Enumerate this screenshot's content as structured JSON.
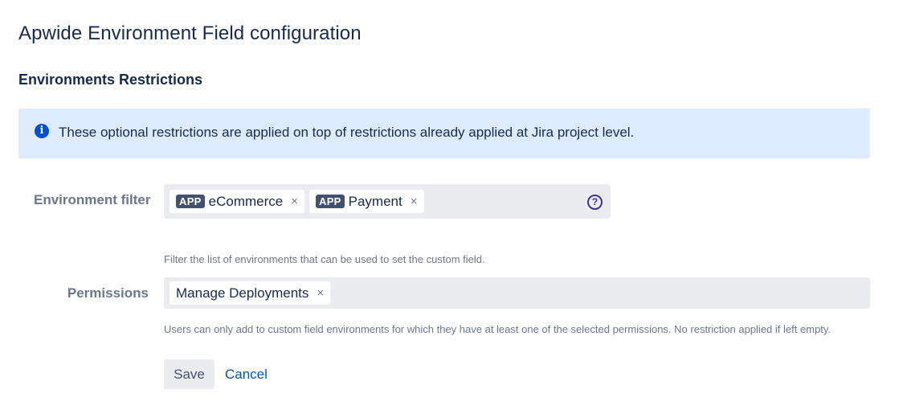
{
  "page": {
    "title": "Apwide Environment Field configuration"
  },
  "section": {
    "title": "Environments Restrictions"
  },
  "info_banner": {
    "icon": "info-icon",
    "glyph": "i",
    "text": "These optional restrictions are applied on top of restrictions already applied at Jira project level."
  },
  "environment_filter": {
    "label": "Environment filter",
    "chips": [
      {
        "badge": "APP",
        "label": "eCommerce",
        "remove": "×"
      },
      {
        "badge": "APP",
        "label": "Payment",
        "remove": "×"
      }
    ],
    "help_icon": "?",
    "help_text": "Filter the list of environments that can be used to set the custom field."
  },
  "permissions": {
    "label": "Permissions",
    "chips": [
      {
        "label": "Manage Deployments",
        "remove": "×"
      }
    ],
    "help_text": "Users can only add to custom field environments for which they have at least one of the selected permissions. No restriction applied if left empty."
  },
  "actions": {
    "save_label": "Save",
    "cancel_label": "Cancel"
  },
  "colors": {
    "banner_background": "#deebff",
    "info_icon": "#0052cc",
    "badge_background": "#42526e",
    "link": "#0052cc",
    "field_background": "#ebecf0"
  }
}
